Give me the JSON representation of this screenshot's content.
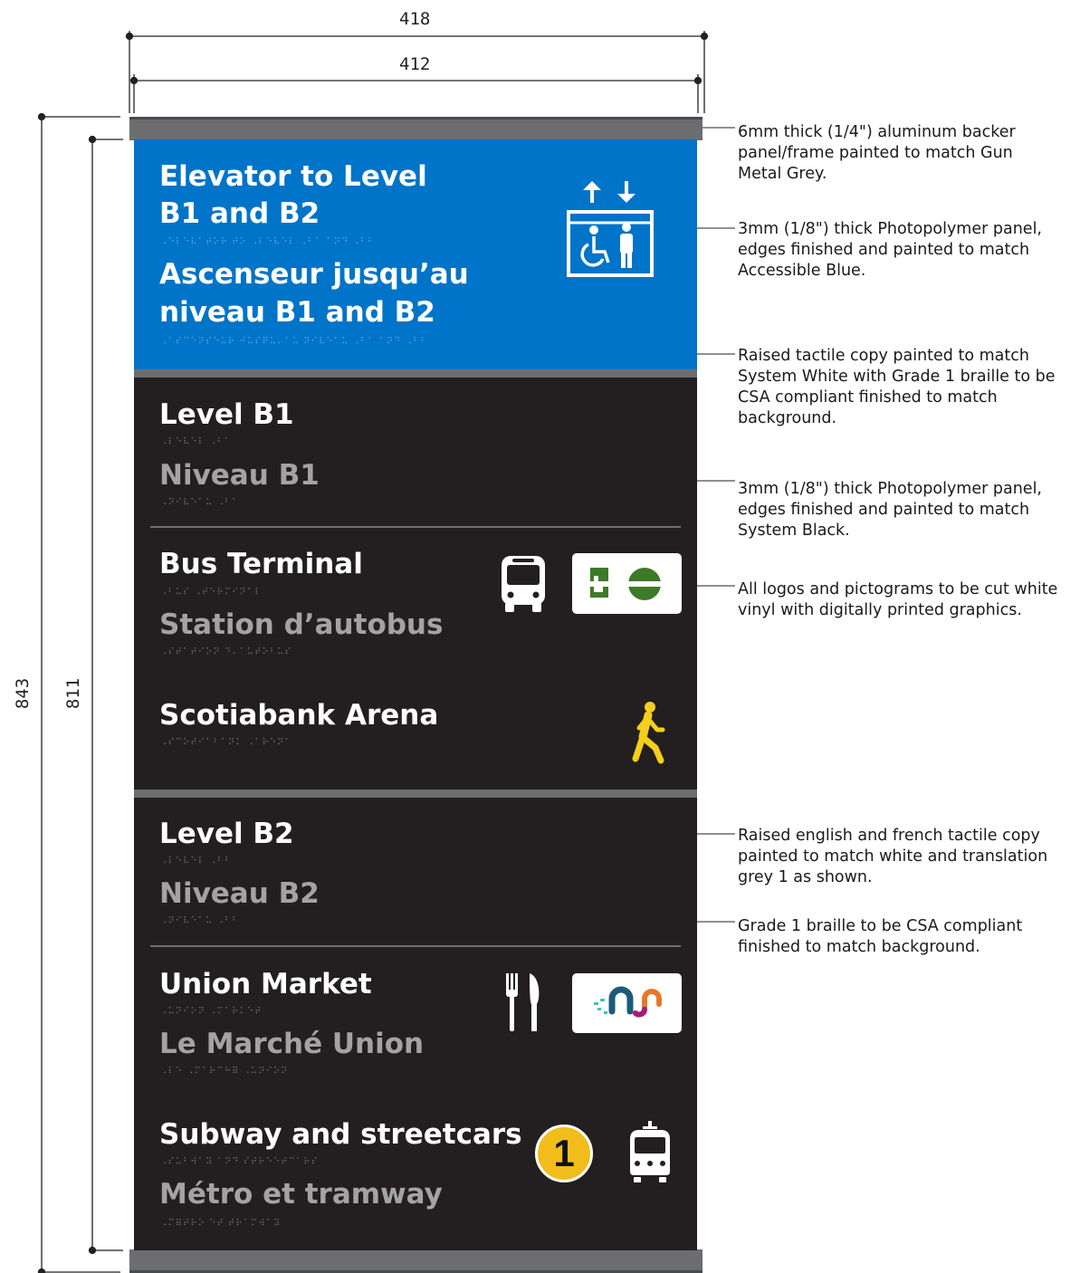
{
  "dimensions": {
    "outer_width": "418",
    "inner_width": "412",
    "outer_height": "843",
    "inner_height": "811"
  },
  "sign": {
    "elevator": {
      "title_line1": "Elevator to Level",
      "title_line2": "B1 and B2",
      "braille1": "⠠⠑⠇⠑⠧⠁⠞⠕⠗ ⠞⠕ ⠠⠇⠑⠧⠑⠇ ⠠⠃⠁ ⠁⠝⠙ ⠠⠃⠃",
      "french_line1": "Ascenseur jusqu’au",
      "french_line2": "niveau B1 and B2",
      "braille2": "⠠⠁⠎⠉⠑⠝⠎⠑⠥⠗ ⠚⠥⠎⠟⠥⠄⠁⠥ ⠝⠊⠧⠑⠁⠥ ⠠⠃⠁ ⠁⠝⠙ ⠠⠃⠃"
    },
    "level_b1": {
      "title": "Level B1",
      "braille": "⠠⠇⠑⠧⠑⠇ ⠠⠃⠁",
      "french": "Niveau B1",
      "braille_fr": "⠠⠝⠊⠧⠑⠁⠥ ⠠⠃⠁"
    },
    "bus": {
      "title": "Bus Terminal",
      "braille": "⠠⠃⠥⠎ ⠠⠞⠑⠗⠍⠊⠝⠁⠇",
      "french": "Station d’autobus",
      "braille_fr": "⠠⠎⠞⠁⠞⠊⠕⠝ ⠙⠄⠁⠥⠞⠕⠃⠥⠎"
    },
    "arena": {
      "title": "Scotiabank Arena",
      "braille": "⠠⠎⠉⠕⠞⠊⠁⠃⠁⠝⠅ ⠠⠁⠗⠑⠝⠁"
    },
    "level_b2": {
      "title": "Level B2",
      "braille": "⠠⠇⠑⠧⠑⠇ ⠠⠃⠃",
      "french": "Niveau B2",
      "braille_fr": "⠠⠝⠊⠧⠑⠁⠥ ⠠⠃⠃"
    },
    "market": {
      "title": "Union Market",
      "braille": "⠠⠥⠝⠊⠕⠝ ⠠⠍⠁⠗⠅⠑⠞",
      "french": "Le Marché Union",
      "braille_fr": "⠠⠇⠑ ⠠⠍⠁⠗⠉⠓⠿ ⠠⠥⠝⠊⠕⠝"
    },
    "subway": {
      "title": "Subway and streetcars",
      "braille": "⠠⠎⠥⠃⠺⠁⠽ ⠁⠝⠙ ⠎⠞⠗⠑⠑⠞⠉⠁⠗⠎",
      "french": "Métro et tramway",
      "braille_fr": "⠠⠍⠿⠞⠗⠕ ⠑⠞ ⠞⠗⠁⠍⠺⠁⠽",
      "line_number": "1"
    }
  },
  "notes": [
    "6mm thick (1/4\") aluminum backer panel/frame painted to match Gun Metal Grey.",
    "3mm (1/8\") thick Photopolymer panel, edges finished and painted to match Accessible Blue.",
    "Raised tactile copy painted to match System White with Grade 1 braille to be CSA compliant finished to match background.",
    "3mm (1/8\") thick Photopolymer panel, edges finished and painted to match System Black.",
    "All logos and pictograms to be cut white vinyl with digitally printed graphics.",
    "Raised english and french tactile copy painted to match white and translation grey 1 as shown.",
    "Grade 1 braille to be CSA compliant finished to match background."
  ],
  "colors": {
    "accessible_blue": "#0074c8",
    "system_black": "#231f20",
    "gun_metal_grey": "#6c6d6f",
    "go_green": "#3d7a28",
    "subway_yellow": "#f2bd1a",
    "pedestrian_yellow": "#f4cf1b"
  },
  "icons": [
    "elevator-accessible-icon",
    "bus-icon",
    "go-transit-logo",
    "pedestrian-icon",
    "fork-knife-icon",
    "union-market-logo",
    "subway-line-1-icon",
    "streetcar-icon"
  ]
}
